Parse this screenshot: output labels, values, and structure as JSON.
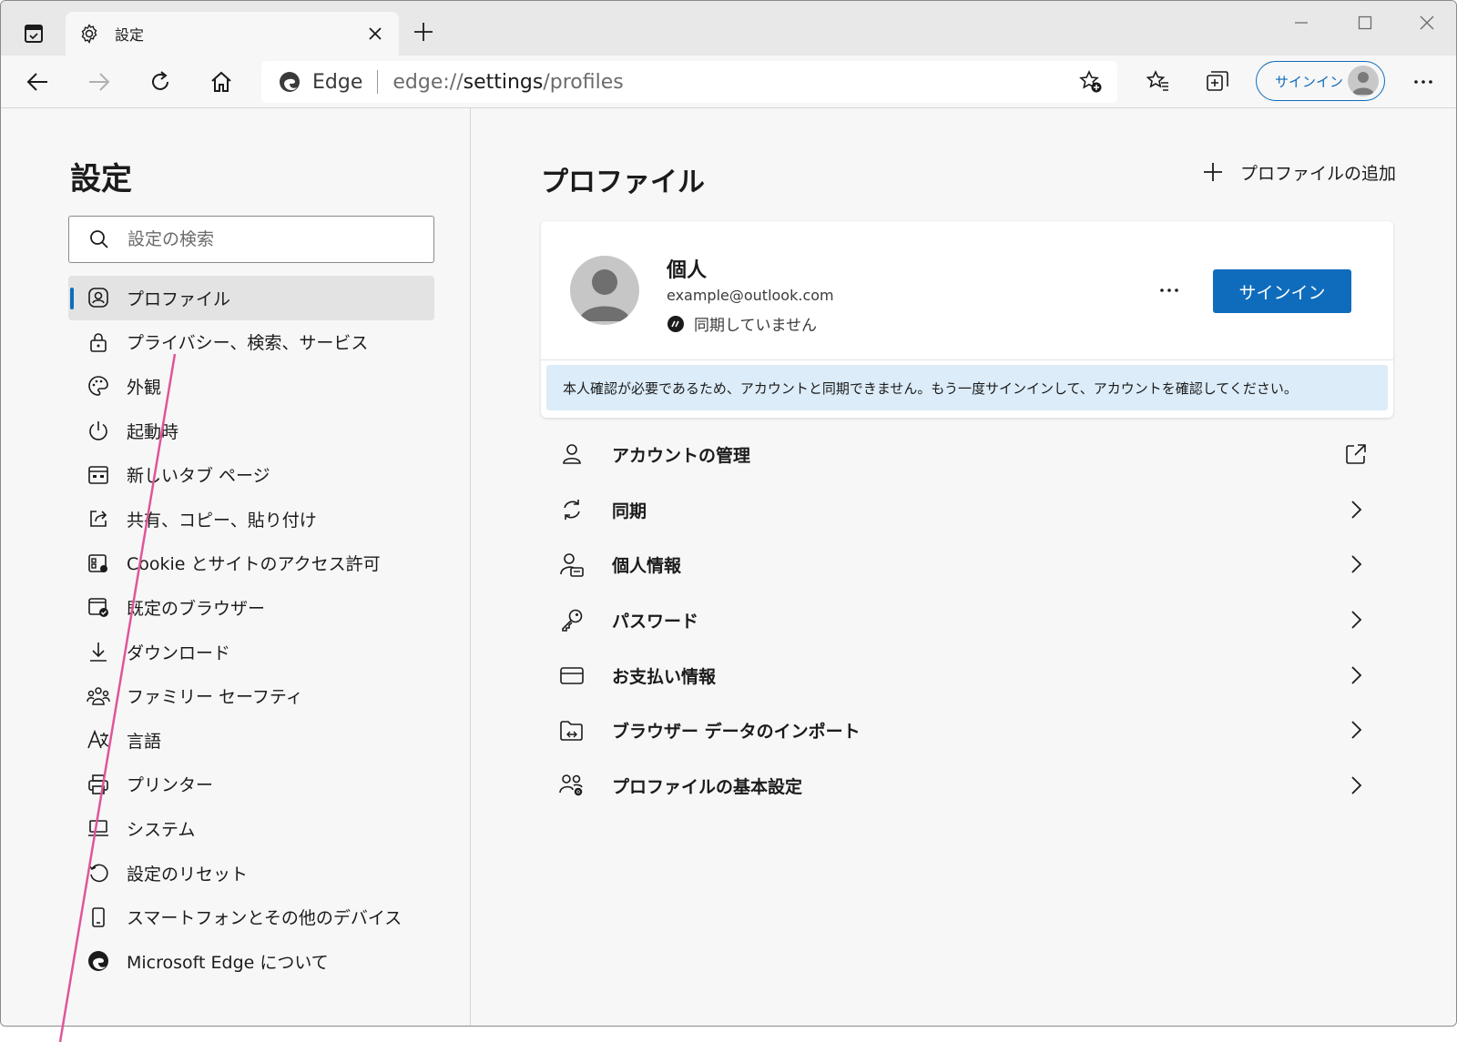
{
  "tab": {
    "title": "設定"
  },
  "address": {
    "brand": "Edge",
    "url_prefix": "edge://",
    "url_main": "settings",
    "url_suffix": "/profiles"
  },
  "toolbar": {
    "signin_label": "サインイン"
  },
  "sidebar": {
    "title": "設定",
    "search_placeholder": "設定の検索",
    "items": [
      {
        "label": "プロファイル",
        "icon": "profile-icon"
      },
      {
        "label": "プライバシー、検索、サービス",
        "icon": "lock-icon"
      },
      {
        "label": "外観",
        "icon": "palette-icon"
      },
      {
        "label": "起動時",
        "icon": "power-icon"
      },
      {
        "label": "新しいタブ ページ",
        "icon": "newtab-icon"
      },
      {
        "label": "共有、コピー、貼り付け",
        "icon": "share-icon"
      },
      {
        "label": "Cookie とサイトのアクセス許可",
        "icon": "cookie-icon"
      },
      {
        "label": "既定のブラウザー",
        "icon": "default-browser-icon"
      },
      {
        "label": "ダウンロード",
        "icon": "download-icon"
      },
      {
        "label": "ファミリー セーフティ",
        "icon": "family-icon"
      },
      {
        "label": "言語",
        "icon": "language-icon"
      },
      {
        "label": "プリンター",
        "icon": "printer-icon"
      },
      {
        "label": "システム",
        "icon": "system-icon"
      },
      {
        "label": "設定のリセット",
        "icon": "reset-icon"
      },
      {
        "label": "スマートフォンとその他のデバイス",
        "icon": "phone-icon"
      },
      {
        "label": "Microsoft Edge について",
        "icon": "edge-icon"
      }
    ]
  },
  "main": {
    "title": "プロファイル",
    "add_profile": "プロファイルの追加",
    "profile": {
      "name": "個人",
      "email": "example@outlook.com",
      "sync_status": "同期していません",
      "signin_button": "サインイン",
      "notice": "本人確認が必要であるため、アカウントと同期できません。もう一度サインインして、アカウントを確認してください。"
    },
    "settings": [
      {
        "label": "アカウントの管理",
        "icon": "account-icon"
      },
      {
        "label": "同期",
        "icon": "sync-icon"
      },
      {
        "label": "個人情報",
        "icon": "personal-info-icon"
      },
      {
        "label": "パスワード",
        "icon": "key-icon"
      },
      {
        "label": "お支払い情報",
        "icon": "card-icon"
      },
      {
        "label": "ブラウザー データのインポート",
        "icon": "import-icon"
      },
      {
        "label": "プロファイルの基本設定",
        "icon": "profile-prefs-icon"
      }
    ]
  },
  "colors": {
    "accent": "#0f6cbd",
    "annotation_line": "#e0559a",
    "notice_bg": "#dcecf8"
  }
}
